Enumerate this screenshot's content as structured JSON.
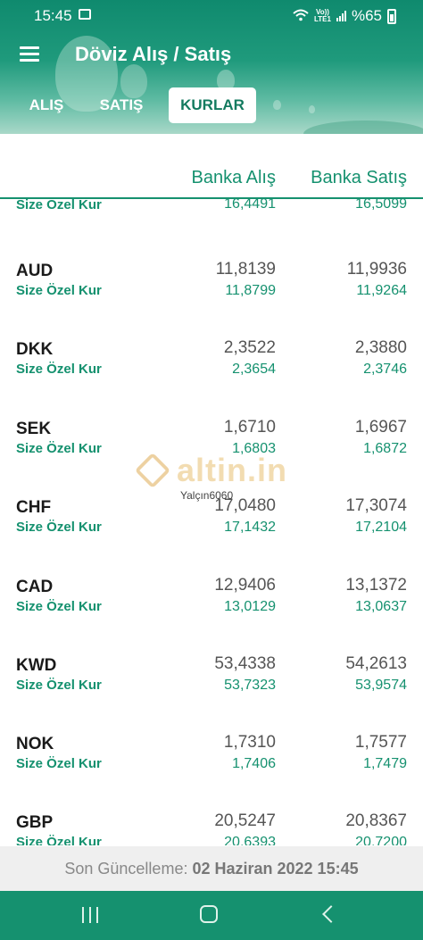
{
  "status": {
    "time": "15:45",
    "lte_top": "Vo))",
    "lte_bottom": "LTE1",
    "battery": "%65"
  },
  "toolbar": {
    "title": "Döviz Alış / Satış"
  },
  "tabs": [
    {
      "label": "ALIŞ",
      "active": false
    },
    {
      "label": "SATIŞ",
      "active": false
    },
    {
      "label": "KURLAR",
      "active": true
    }
  ],
  "columns": {
    "buy": "Banka Alış",
    "sell": "Banka Satış"
  },
  "special_label": "Size Özel Kur",
  "rows": [
    {
      "code": "",
      "buy": "",
      "sell": "",
      "special_buy": "16,4491",
      "special_sell": "16,5099"
    },
    {
      "code": "AUD",
      "buy": "11,8139",
      "sell": "11,9936",
      "special_buy": "11,8799",
      "special_sell": "11,9264"
    },
    {
      "code": "DKK",
      "buy": "2,3522",
      "sell": "2,3880",
      "special_buy": "2,3654",
      "special_sell": "2,3746"
    },
    {
      "code": "SEK",
      "buy": "1,6710",
      "sell": "1,6967",
      "special_buy": "1,6803",
      "special_sell": "1,6872"
    },
    {
      "code": "CHF",
      "buy": "17,0480",
      "sell": "17,3074",
      "special_buy": "17,1432",
      "special_sell": "17,2104"
    },
    {
      "code": "CAD",
      "buy": "12,9406",
      "sell": "13,1372",
      "special_buy": "13,0129",
      "special_sell": "13,0637"
    },
    {
      "code": "KWD",
      "buy": "53,4338",
      "sell": "54,2613",
      "special_buy": "53,7323",
      "special_sell": "53,9574"
    },
    {
      "code": "NOK",
      "buy": "1,7310",
      "sell": "1,7577",
      "special_buy": "1,7406",
      "special_sell": "1,7479"
    },
    {
      "code": "GBP",
      "buy": "20,5247",
      "sell": "20,8367",
      "special_buy": "20,6393",
      "special_sell": "20,7200"
    }
  ],
  "watermark": {
    "brand": "altin.in",
    "user": "Yalçın6060"
  },
  "footer": {
    "label": "Son Güncelleme:",
    "value": "02 Haziran 2022 15:45"
  },
  "colors": {
    "accent": "#15916f",
    "header": "#0f8a6e"
  },
  "icons": [
    "menu-icon",
    "wifi-icon",
    "signal-icon",
    "battery-icon",
    "recent-apps-icon",
    "home-icon",
    "back-icon"
  ]
}
